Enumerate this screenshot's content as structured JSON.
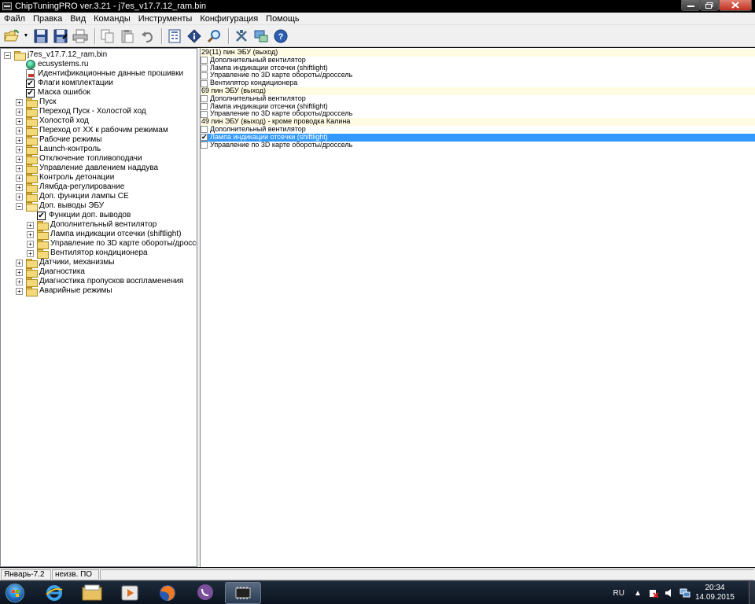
{
  "window": {
    "title": "ChipTuningPRO ver.3.21 - j7es_v17.7.12_ram.bin"
  },
  "menu": [
    "Файл",
    "Правка",
    "Вид",
    "Команды",
    "Инструменты",
    "Конфигурация",
    "Помощь"
  ],
  "toolbar": {
    "buttons": [
      "open-icon",
      "save-icon",
      "save-as-icon",
      "print-icon",
      "copy-icon",
      "paste-icon",
      "undo-icon",
      "calculator-icon",
      "info-icon",
      "search-icon",
      "tools-icon",
      "connect-icon",
      "help-icon"
    ]
  },
  "tree": {
    "root": "j7es_v17.7.12_ram.bin",
    "items": [
      {
        "label": "ecusystems.ru",
        "icon": "globe-icon",
        "depth": 1,
        "expander": ""
      },
      {
        "label": "Идентификационные данные прошивки",
        "icon": "document-icon",
        "depth": 1,
        "expander": ""
      },
      {
        "label": "Флаги комплектации",
        "icon": "checkbox-icon",
        "depth": 1,
        "expander": ""
      },
      {
        "label": "Маска ошибок",
        "icon": "checkbox-icon",
        "depth": 1,
        "expander": ""
      },
      {
        "label": "Пуск",
        "icon": "folder-icon",
        "depth": 1,
        "expander": "+"
      },
      {
        "label": "Переход Пуск - Холостой ход",
        "icon": "folder-icon",
        "depth": 1,
        "expander": "+"
      },
      {
        "label": "Холостой ход",
        "icon": "folder-icon",
        "depth": 1,
        "expander": "+"
      },
      {
        "label": "Переход от ХХ к рабочим режимам",
        "icon": "folder-icon",
        "depth": 1,
        "expander": "+"
      },
      {
        "label": "Рабочие режимы",
        "icon": "folder-icon",
        "depth": 1,
        "expander": "+"
      },
      {
        "label": "Launch-контроль",
        "icon": "folder-icon",
        "depth": 1,
        "expander": "+"
      },
      {
        "label": "Отключение топливоподачи",
        "icon": "folder-icon",
        "depth": 1,
        "expander": "+"
      },
      {
        "label": "Управление давлением наддува",
        "icon": "folder-icon",
        "depth": 1,
        "expander": "+"
      },
      {
        "label": "Контроль детонации",
        "icon": "folder-icon",
        "depth": 1,
        "expander": "+"
      },
      {
        "label": "Лямбда-регулирование",
        "icon": "folder-icon",
        "depth": 1,
        "expander": "+"
      },
      {
        "label": "Доп. функции лампы CE",
        "icon": "folder-icon",
        "depth": 1,
        "expander": "+"
      },
      {
        "label": "Доп. выводы ЭБУ",
        "icon": "folder-open-icon",
        "depth": 1,
        "expander": "−"
      },
      {
        "label": "Функции доп. выводов",
        "icon": "checkbox-icon",
        "depth": 2,
        "expander": ""
      },
      {
        "label": "Дополнительный вентилятор",
        "icon": "folder-icon",
        "depth": 2,
        "expander": "+"
      },
      {
        "label": "Лампа индикации отсечки (shiftlight)",
        "icon": "folder-icon",
        "depth": 2,
        "expander": "+"
      },
      {
        "label": "Управление по 3D карте обороты/дроссель",
        "icon": "folder-icon",
        "depth": 2,
        "expander": "+"
      },
      {
        "label": "Вентилятор кондиционера",
        "icon": "folder-icon",
        "depth": 2,
        "expander": "+"
      },
      {
        "label": "Датчики, механизмы",
        "icon": "folder-icon",
        "depth": 1,
        "expander": "+"
      },
      {
        "label": "Диагностика",
        "icon": "folder-icon",
        "depth": 1,
        "expander": "+"
      },
      {
        "label": "Диагностика пропусков воспламенения",
        "icon": "folder-icon",
        "depth": 1,
        "expander": "+"
      },
      {
        "label": "Аварийные режимы",
        "icon": "folder-icon",
        "depth": 1,
        "expander": "+"
      }
    ]
  },
  "list": {
    "rows": [
      {
        "type": "header",
        "label": "29(11) пин ЭБУ (выход)"
      },
      {
        "type": "item",
        "label": "Дополнительный вентилятор",
        "checked": false
      },
      {
        "type": "item",
        "label": "Лампа индикации отсечки (shiftlight)",
        "checked": false
      },
      {
        "type": "item",
        "label": "Управление по 3D карте обороты/дроссель",
        "checked": false
      },
      {
        "type": "item",
        "label": "Вентилятор кондиционера",
        "checked": false
      },
      {
        "type": "header",
        "label": "69 пин ЭБУ (выход)"
      },
      {
        "type": "item",
        "label": "Дополнительный вентилятор",
        "checked": false
      },
      {
        "type": "item",
        "label": "Лампа индикации отсечки (shiftlight)",
        "checked": false
      },
      {
        "type": "item",
        "label": "Управление по 3D карте обороты/дроссель",
        "checked": false
      },
      {
        "type": "header",
        "label": "49 пин ЭБУ (выход) - кроме проводка Калина"
      },
      {
        "type": "item",
        "label": "Дополнительный вентилятор",
        "checked": false
      },
      {
        "type": "item",
        "label": "Лампа индикации отсечки (shiftlight)",
        "checked": true,
        "selected": true
      },
      {
        "type": "item",
        "label": "Управление по 3D карте обороты/дроссель",
        "checked": false
      }
    ]
  },
  "status": {
    "firmware": "Январь-7.2",
    "software": "неизв. ПО"
  },
  "taskbar": {
    "lang": "RU",
    "time": "20:34",
    "date": "14.09.2015"
  },
  "colors": {
    "selection": "#3399ff",
    "header_bg": "#fffbe3"
  }
}
